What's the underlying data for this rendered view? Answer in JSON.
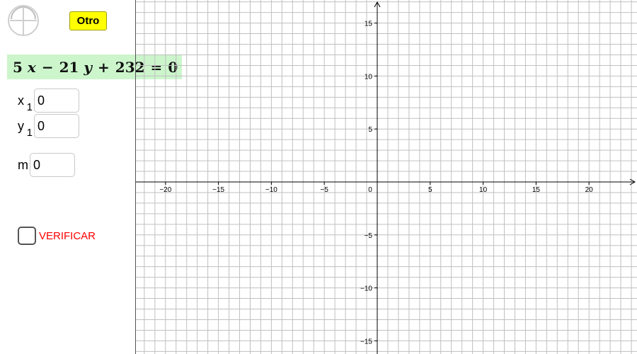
{
  "app": {
    "reset_icon": "reset-view-icon",
    "otro_button_label": "Otro"
  },
  "equation": {
    "a": "5",
    "x_var": "x",
    "op1": "−",
    "b": "21",
    "y_var": "y",
    "op2": "+",
    "c": "232",
    "eq": "=",
    "rhs": "0"
  },
  "fields": {
    "x1": {
      "label": "x",
      "sub": "1",
      "value": "0"
    },
    "y1": {
      "label": "y",
      "sub": "1",
      "value": "0"
    },
    "m": {
      "label": "m",
      "value": "0"
    }
  },
  "verify": {
    "label": "VERIFICAR",
    "checked": false,
    "color": "#ff0000"
  },
  "graph": {
    "x_range": [
      -22,
      24
    ],
    "y_range": [
      -16,
      17
    ],
    "grid_step": 1,
    "x_tick_labels": [
      "−20",
      "−15",
      "−10",
      "−5",
      "0",
      "5",
      "10",
      "15",
      "20"
    ],
    "y_tick_labels": [
      "15",
      "10",
      "5",
      "−5",
      "−10",
      "−15"
    ],
    "grid_color": "#c0c0c0",
    "axis_color": "#000000"
  }
}
